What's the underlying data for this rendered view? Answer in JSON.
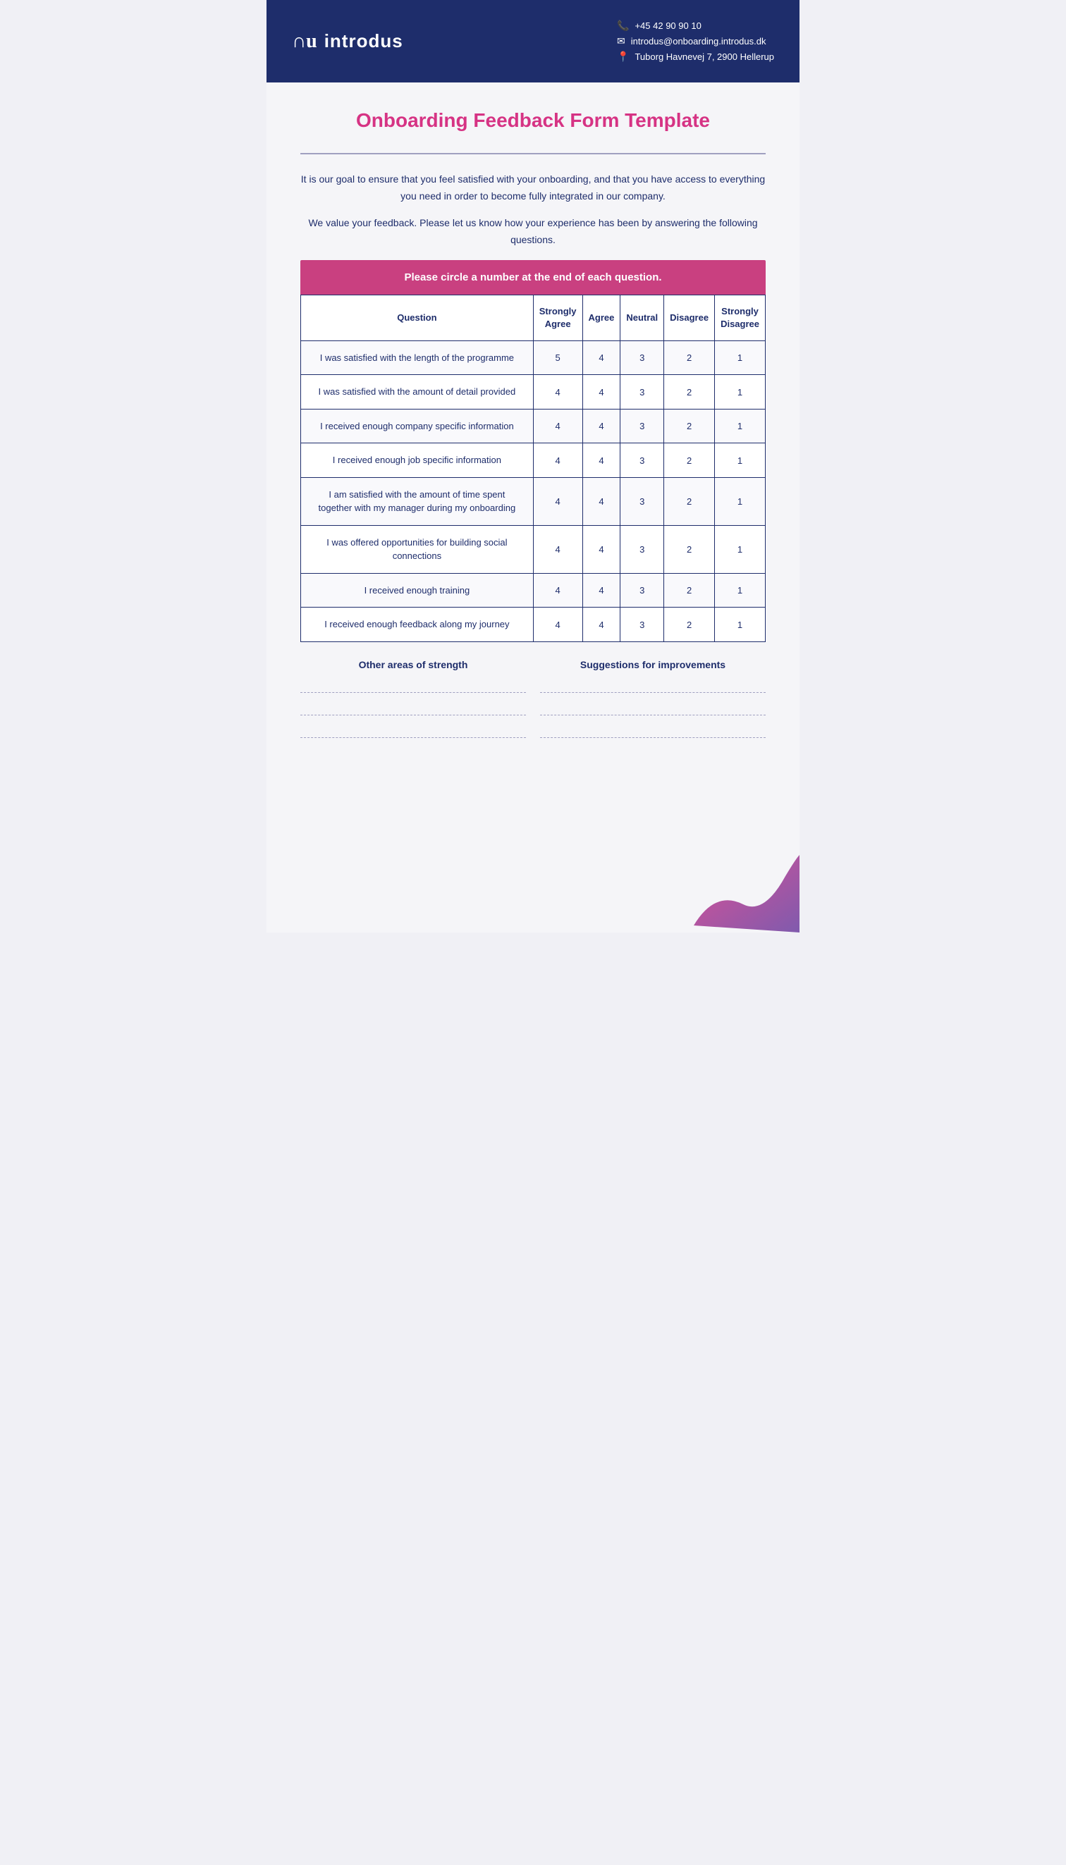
{
  "header": {
    "logo_symbol": "∩u",
    "logo_name": "introdus",
    "phone": "+45 42 90 90 10",
    "email": "introdus@onboarding.introdus.dk",
    "address": "Tuborg Havnevej 7, 2900 Hellerup"
  },
  "form": {
    "title": "Onboarding Feedback Form Template",
    "intro1": "It is our goal to ensure that you feel satisfied with your onboarding, and that you have access to everything you need in order to become fully integrated in our company.",
    "intro2": "We value your feedback. Please let us know how your experience has been by answering the following questions.",
    "banner": "Please circle a number at the end of each question.",
    "table": {
      "headers": [
        "Question",
        "Strongly Agree",
        "Agree",
        "Neutral",
        "Disagree",
        "Strongly Disagree"
      ],
      "rows": [
        {
          "question": "I was satisfied with the length of the programme",
          "strongly_agree": "5",
          "agree": "4",
          "neutral": "3",
          "disagree": "2",
          "strongly_disagree": "1"
        },
        {
          "question": "I was satisfied with the amount of detail provided",
          "strongly_agree": "4",
          "agree": "4",
          "neutral": "3",
          "disagree": "2",
          "strongly_disagree": "1"
        },
        {
          "question": "I received enough company specific information",
          "strongly_agree": "4",
          "agree": "4",
          "neutral": "3",
          "disagree": "2",
          "strongly_disagree": "1"
        },
        {
          "question": "I received enough job specific information",
          "strongly_agree": "4",
          "agree": "4",
          "neutral": "3",
          "disagree": "2",
          "strongly_disagree": "1"
        },
        {
          "question": "I am satisfied with the amount of time spent together with my manager during my onboarding",
          "strongly_agree": "4",
          "agree": "4",
          "neutral": "3",
          "disagree": "2",
          "strongly_disagree": "1"
        },
        {
          "question": "I was offered opportunities for building social connections",
          "strongly_agree": "4",
          "agree": "4",
          "neutral": "3",
          "disagree": "2",
          "strongly_disagree": "1"
        },
        {
          "question": "I received enough training",
          "strongly_agree": "4",
          "agree": "4",
          "neutral": "3",
          "disagree": "2",
          "strongly_disagree": "1"
        },
        {
          "question": "I received enough feedback along my journey",
          "strongly_agree": "4",
          "agree": "4",
          "neutral": "3",
          "disagree": "2",
          "strongly_disagree": "1"
        }
      ]
    },
    "other_areas_label": "Other areas of strength",
    "suggestions_label": "Suggestions for improvements",
    "write_lines": 3
  }
}
